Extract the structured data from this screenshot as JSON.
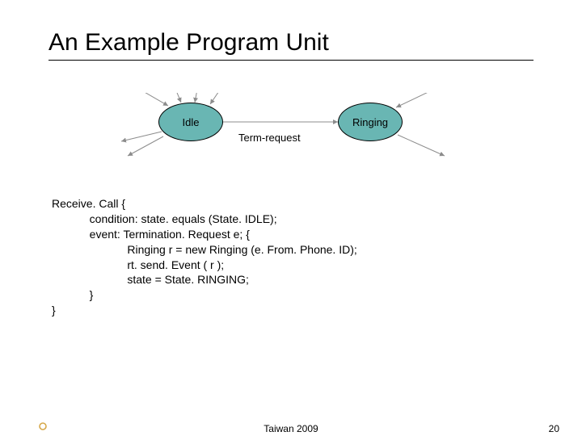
{
  "title": "An Example Program Unit",
  "diagram": {
    "state_idle": "Idle",
    "state_ringing": "Ringing",
    "edge_label": "Term-request"
  },
  "code": {
    "l1": "Receive. Call {",
    "l2": "            condition: state. equals (State. IDLE);",
    "l3": "            event: Termination. Request e; {",
    "l4": "                        Ringing r = new Ringing (e. From. Phone. ID);",
    "l5": "                        rt. send. Event ( r );",
    "l6": "                        state = State. RINGING;",
    "l7": "            }",
    "l8": "}"
  },
  "footer": {
    "center": "Taiwan 2009",
    "page": "20"
  }
}
